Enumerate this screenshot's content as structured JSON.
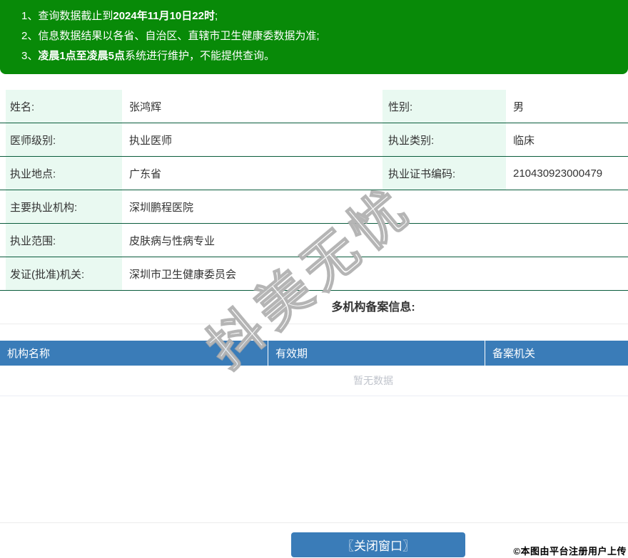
{
  "notices": {
    "items": [
      {
        "num": "1、",
        "pre": "查询数据截止到",
        "bold": "2024年11月10日22时",
        "post": ";"
      },
      {
        "num": "2、",
        "pre": "信息数据结果以各省、自治区、直辖市卫生健康委数据为准;",
        "bold": "",
        "post": ""
      },
      {
        "num": "3、",
        "pre": "",
        "bold": "凌晨1点至凌晨5点",
        "post": "系统进行维护，不能提供查询。"
      }
    ]
  },
  "info": {
    "rows": [
      {
        "label": "姓名:",
        "value": "张鸿辉",
        "label2": "性别:",
        "value2": "男"
      },
      {
        "label": "医师级别:",
        "value": "执业医师",
        "label2": "执业类别:",
        "value2": "临床"
      },
      {
        "label": "执业地点:",
        "value": "广东省",
        "label2": "执业证书编码:",
        "value2": "210430923000479"
      },
      {
        "label": "主要执业机构:",
        "value": "深圳鹏程医院"
      },
      {
        "label": "执业范围:",
        "value": "皮肤病与性病专业"
      },
      {
        "label": "发证(批准)机关:",
        "value": "深圳市卫生健康委员会"
      }
    ]
  },
  "filing": {
    "title": "多机构备案信息:",
    "headers": [
      "机构名称",
      "有效期",
      "备案机关"
    ],
    "empty_text": "暂无数据"
  },
  "footer": {
    "close_button": "〖关闭窗口〗",
    "copyright": "©本图由平台注册用户上传"
  },
  "watermark": "抖美无忧",
  "colors": {
    "notice_green": "#088a08",
    "row_border_green": "#0a5c3c",
    "label_mint": "#e9f9f1",
    "header_blue": "#3a7cb8",
    "empty_text_gray": "#c0c4cc"
  }
}
